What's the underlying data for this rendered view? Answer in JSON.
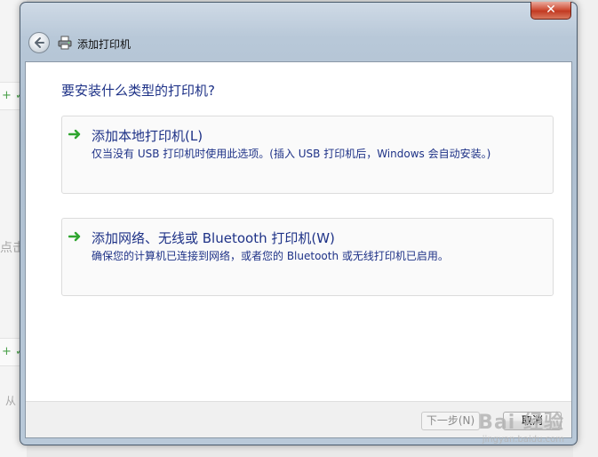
{
  "window": {
    "title": "添加打印机",
    "close_glyph": "✕"
  },
  "page": {
    "heading": "要安装什么类型的打印机?"
  },
  "options": [
    {
      "title": "添加本地打印机(L)",
      "description": "仅当没有 USB 打印机时使用此选项。(插入 USB 打印机后，Windows 会自动安装。)"
    },
    {
      "title": "添加网络、无线或 Bluetooth 打印机(W)",
      "description": "确保您的计算机已连接到网络，或者您的 Bluetooth 或无线打印机已启用。"
    }
  ],
  "footer": {
    "next_label": "下一步(N)",
    "cancel_label": "取消"
  },
  "background": {
    "fragment_1": "点击",
    "fragment_2": "从"
  },
  "watermark": {
    "logo": "Bai 经验",
    "url": "jingyan.baidu.com"
  },
  "colors": {
    "link_blue": "#1e3287",
    "arrow_green": "#2fa52f",
    "close_red": "#c23a22"
  },
  "icons": {
    "back": "back-arrow-icon",
    "printer": "printer-icon",
    "option_arrow": "green-arrow-icon",
    "close": "close-icon"
  }
}
